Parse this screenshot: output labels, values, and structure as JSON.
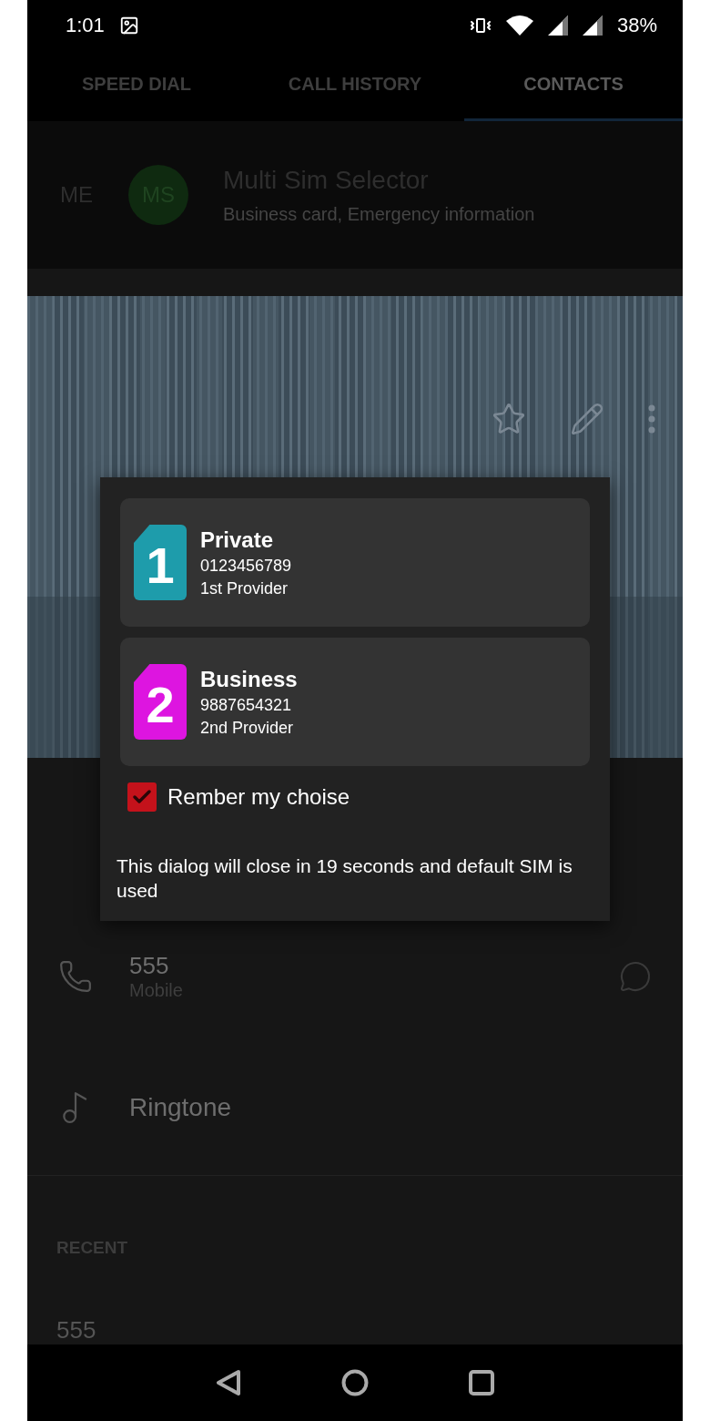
{
  "status_bar": {
    "time": "1:01",
    "battery": "38%"
  },
  "tabs": [
    {
      "label": "SPEED DIAL",
      "selected": false
    },
    {
      "label": "CALL HISTORY",
      "selected": false
    },
    {
      "label": "CONTACTS",
      "selected": true
    }
  ],
  "me": {
    "label": "ME",
    "initials": "MS",
    "name": "Multi Sim Selector",
    "subtitle": "Business card, Emergency information"
  },
  "details": [
    {
      "kind": "phone",
      "value": "555",
      "label": "Mobile"
    },
    {
      "kind": "ringtone",
      "value": "Ringtone"
    }
  ],
  "recent": {
    "heading": "RECENT",
    "items": [
      "555"
    ]
  },
  "dialog": {
    "sims": [
      {
        "slot": "1",
        "name": "Private",
        "number": "0123456789",
        "provider": "1st Provider",
        "color": "#1e9cab"
      },
      {
        "slot": "2",
        "name": "Business",
        "number": "9887654321",
        "provider": "2nd Provider",
        "color": "#dd15e0"
      }
    ],
    "remember": {
      "label": "Rember my choise",
      "checked": true
    },
    "message": "This dialog will close in 19 seconds and default SIM is used"
  }
}
